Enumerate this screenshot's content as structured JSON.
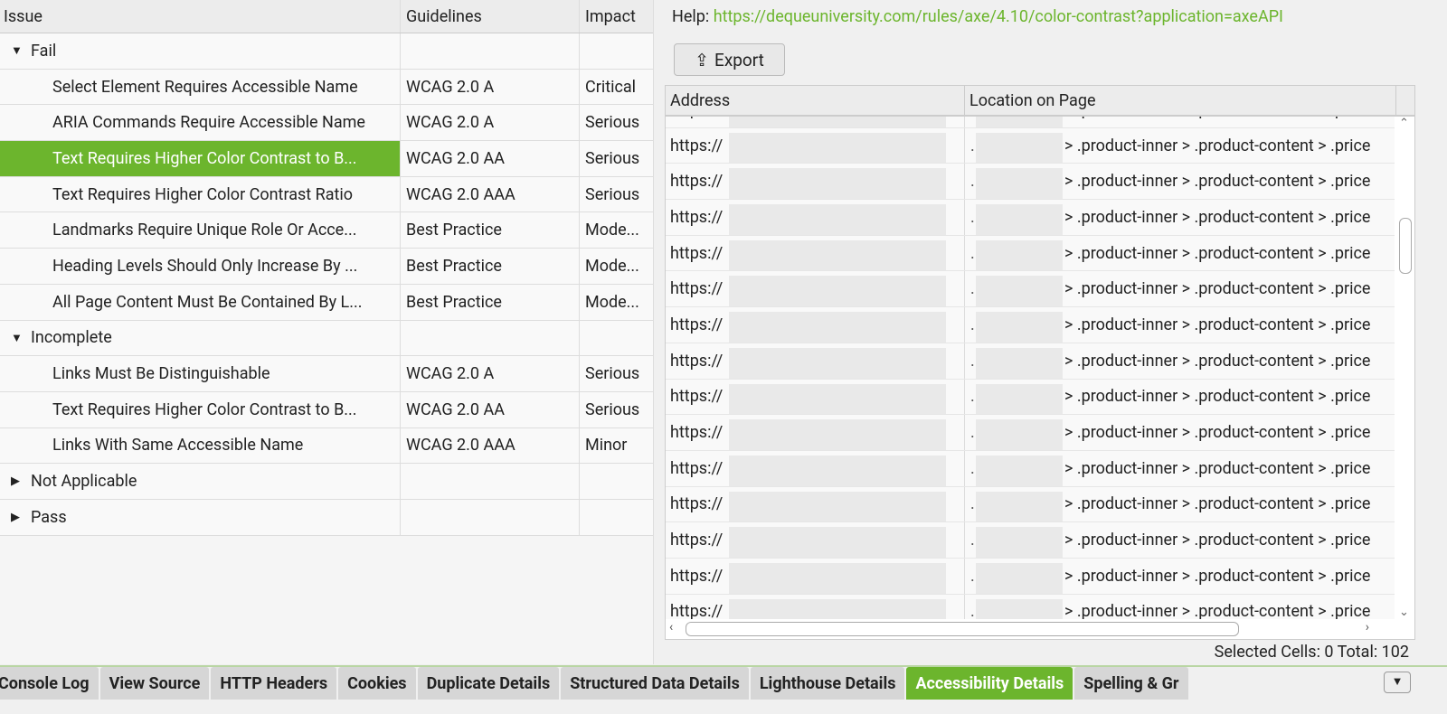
{
  "issues": {
    "headers": {
      "issue": "Issue",
      "guidelines": "Guidelines",
      "impact": "Impact"
    },
    "rows": [
      {
        "type": "group",
        "label": "Fail",
        "expanded": true
      },
      {
        "type": "item",
        "issue": "Select Element Requires Accessible Name",
        "guidelines": "WCAG 2.0 A",
        "impact": "Critical"
      },
      {
        "type": "item",
        "issue": "ARIA Commands Require Accessible Name",
        "guidelines": "WCAG 2.0 A",
        "impact": "Serious"
      },
      {
        "type": "item",
        "issue": "Text Requires Higher Color Contrast to B...",
        "guidelines": "WCAG 2.0 AA",
        "impact": "Serious",
        "selected": true
      },
      {
        "type": "item",
        "issue": "Text Requires Higher Color Contrast Ratio",
        "guidelines": "WCAG 2.0 AAA",
        "impact": "Serious"
      },
      {
        "type": "item",
        "issue": "Landmarks Require Unique Role Or Acce...",
        "guidelines": "Best Practice",
        "impact": "Mode..."
      },
      {
        "type": "item",
        "issue": "Heading Levels Should Only Increase By ...",
        "guidelines": "Best Practice",
        "impact": "Mode..."
      },
      {
        "type": "item",
        "issue": "All Page Content Must Be Contained By L...",
        "guidelines": "Best Practice",
        "impact": "Mode..."
      },
      {
        "type": "group",
        "label": "Incomplete",
        "expanded": true
      },
      {
        "type": "item",
        "issue": "Links Must Be Distinguishable",
        "guidelines": "WCAG 2.0 A",
        "impact": "Serious"
      },
      {
        "type": "item",
        "issue": "Text Requires Higher Color Contrast to B...",
        "guidelines": "WCAG 2.0 AA",
        "impact": "Serious"
      },
      {
        "type": "item",
        "issue": "Links With Same Accessible Name",
        "guidelines": "WCAG 2.0 AAA",
        "impact": "Minor"
      },
      {
        "type": "group",
        "label": "Not Applicable",
        "expanded": false
      },
      {
        "type": "group",
        "label": "Pass",
        "expanded": false
      }
    ]
  },
  "details": {
    "help_label": "Help:",
    "help_url": "https://dequeuniversity.com/rules/axe/4.10/color-contrast?application=axeAPI",
    "export_label": "Export",
    "headers": {
      "address": "Address",
      "location": "Location on Page"
    },
    "rows": [
      {
        "address": "https://",
        "location": "> .product-inner > .product-content > .price"
      },
      {
        "address": "https://",
        "location": "> .product-inner > .product-content > .price"
      },
      {
        "address": "https://",
        "location": "> .product-inner > .product-content > .price"
      },
      {
        "address": "https://",
        "location": "> .product-inner > .product-content > .price"
      },
      {
        "address": "https://",
        "location": "> .product-inner > .product-content > .price"
      },
      {
        "address": "https://",
        "location": "> .product-inner > .product-content > .price"
      },
      {
        "address": "https://",
        "location": "> .product-inner > .product-content > .price"
      },
      {
        "address": "https://",
        "location": "> .product-inner > .product-content > .price"
      },
      {
        "address": "https://",
        "location": "> .product-inner > .product-content > .price"
      },
      {
        "address": "https://",
        "location": "> .product-inner > .product-content > .price"
      },
      {
        "address": "https://",
        "location": "> .product-inner > .product-content > .price"
      },
      {
        "address": "https://",
        "location": "> .product-inner > .product-content > .price"
      },
      {
        "address": "https://",
        "location": "> .product-inner > .product-content > .price"
      },
      {
        "address": "https://",
        "location": "> .product-inner > .product-content > .price"
      },
      {
        "address": "https://",
        "location": "> .product-inner > .product-content > .price"
      }
    ],
    "status": "Selected Cells:  0  Total:  102"
  },
  "tabs": [
    "Console Log",
    "View Source",
    "HTTP Headers",
    "Cookies",
    "Duplicate Details",
    "Structured Data Details",
    "Lighthouse Details",
    "Accessibility Details",
    "Spelling & Gr"
  ],
  "active_tab": "Accessibility Details",
  "colors": {
    "accent": "#6cb52d"
  }
}
